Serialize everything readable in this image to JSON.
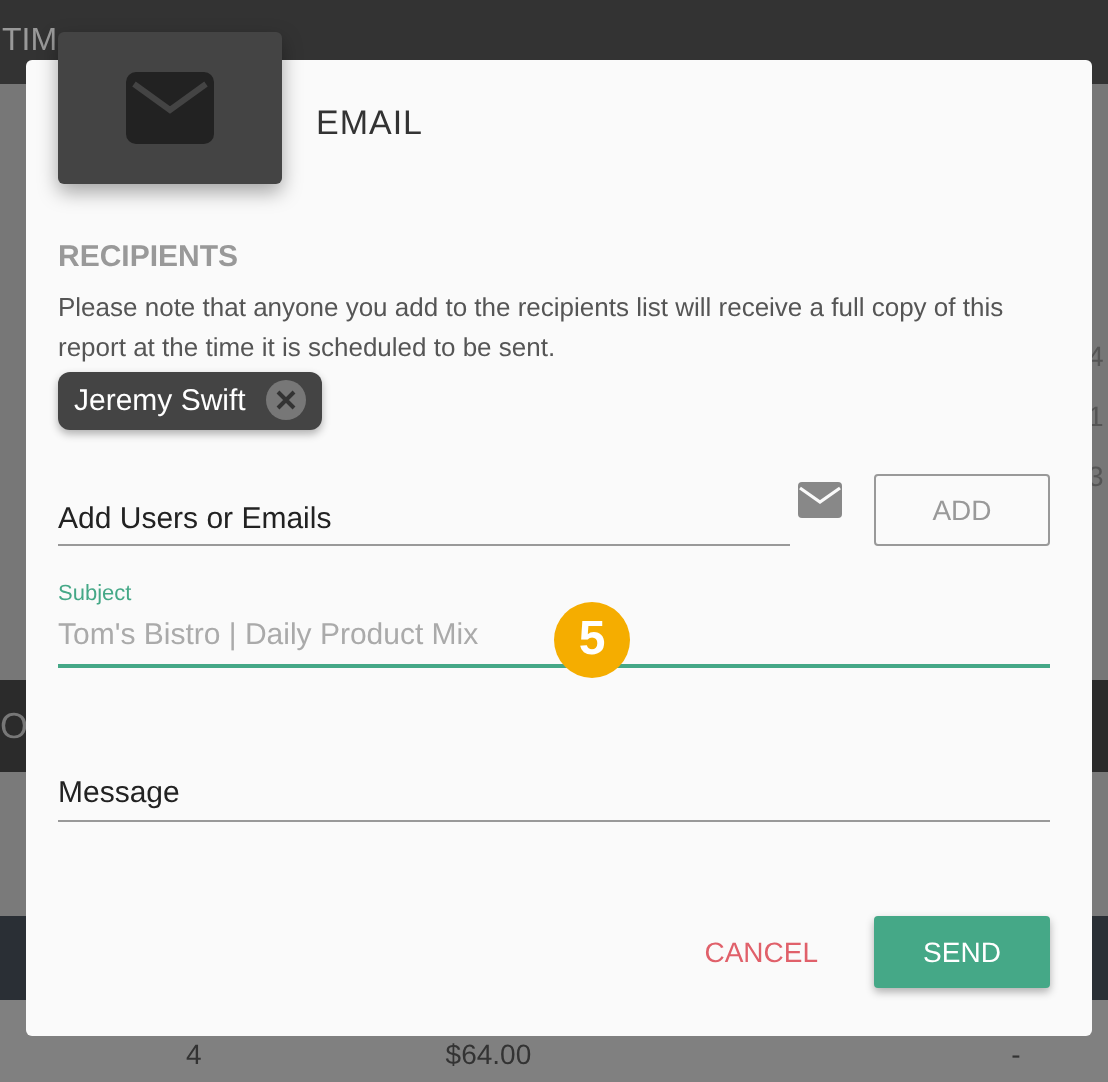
{
  "background": {
    "header_text": "TIM",
    "band_left": "O",
    "side_digits": [
      "4",
      "1",
      "3"
    ],
    "row": [
      "4",
      "$64.00",
      "-"
    ]
  },
  "dialog": {
    "title": "EMAIL",
    "recipients": {
      "heading": "RECIPIENTS",
      "note": "Please note that anyone you add to the recipients list will receive a full copy of this report at the time it is scheduled to be sent.",
      "chips": [
        "Jeremy Swift"
      ]
    },
    "add_field": {
      "placeholder": "Add Users or Emails",
      "button": "ADD",
      "disabled": true
    },
    "subject": {
      "label": "Subject",
      "placeholder": "Tom's Bistro | Daily Product Mix",
      "focused": true
    },
    "step_badge": "5",
    "message": {
      "placeholder": "Message"
    },
    "buttons": [
      {
        "label": "CANCEL",
        "kind": "text"
      },
      {
        "label": "SEND",
        "kind": "primary"
      }
    ]
  }
}
